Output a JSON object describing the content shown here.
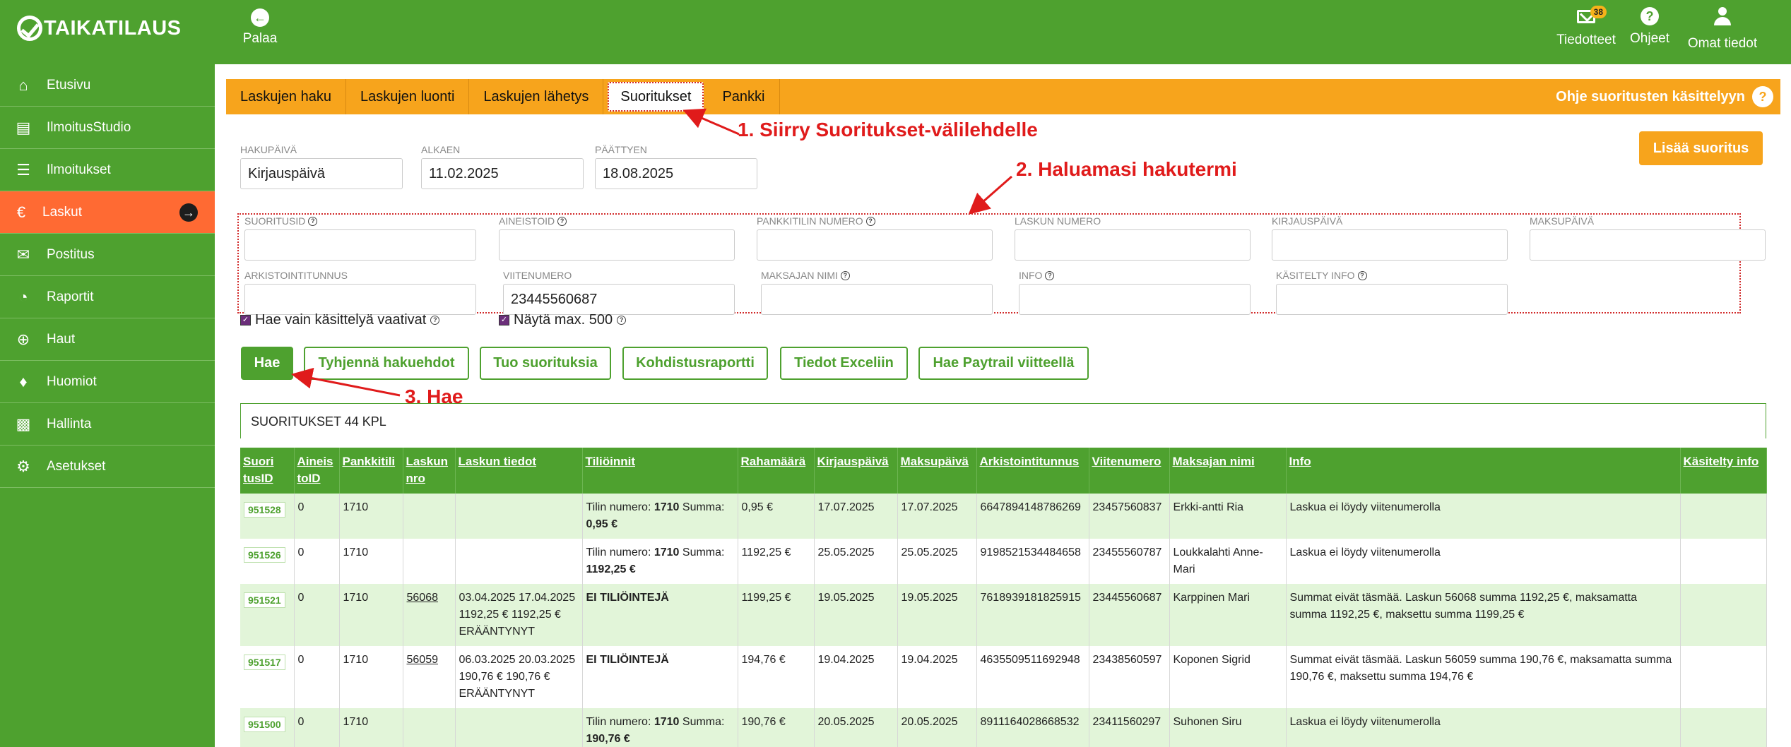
{
  "topbar": {
    "logo_text": "TAIKATILAUS",
    "back_label": "Palaa",
    "notifications_label": "Tiedotteet",
    "notifications_count": "38",
    "help_label": "Ohjeet",
    "profile_label": "Omat tiedot"
  },
  "sidebar": {
    "items": [
      {
        "label": "Etusivu",
        "icon": "home-icon"
      },
      {
        "label": "IlmoitusStudio",
        "icon": "newspaper-icon"
      },
      {
        "label": "Ilmoitukset",
        "icon": "list-icon"
      },
      {
        "label": "Laskut",
        "icon": "euro-icon",
        "active": true
      },
      {
        "label": "Postitus",
        "icon": "envelope-icon"
      },
      {
        "label": "Raportit",
        "icon": "pie-chart-icon"
      },
      {
        "label": "Haut",
        "icon": "search-plus-icon"
      },
      {
        "label": "Huomiot",
        "icon": "bell-icon"
      },
      {
        "label": "Hallinta",
        "icon": "cubes-icon"
      },
      {
        "label": "Asetukset",
        "icon": "gear-icon"
      }
    ]
  },
  "tabs": {
    "items": [
      "Laskujen haku",
      "Laskujen luonti",
      "Laskujen lähetys",
      "Suoritukset",
      "Pankki"
    ],
    "help_text": "Ohje suoritusten käsittelyyn"
  },
  "annotations": {
    "step1": "1. Siirry Suoritukset-välilehdelle",
    "step2": "2. Haluamasi hakutermi",
    "step3": "3. Hae"
  },
  "search": {
    "hakupaiva_label": "HAKUPÄIVÄ",
    "hakupaiva_value": "Kirjauspäivä",
    "alkaen_label": "ALKAEN",
    "alkaen_value": "11.02.2025",
    "paattyen_label": "PÄÄTTYEN",
    "paattyen_value": "18.08.2025",
    "add_button": "Lisää suoritus"
  },
  "filters": {
    "suoritusid": "SUORITUSID",
    "aineistoid": "AINEISTOID",
    "pankkitili": "PANKKITILIN NUMERO",
    "laskun_numero": "LASKUN NUMERO",
    "kirjauspaiva": "KIRJAUSPÄIVÄ",
    "maksupaiva": "MAKSUPÄIVÄ",
    "arkistointitunnus": "ARKISTOINTITUNNUS",
    "viitenumero": "VIITENUMERO",
    "viitenumero_value": "23445560687",
    "maksajan_nimi": "MAKSAJAN NIMI",
    "info": "INFO",
    "kasitelty_info": "KÄSITELTY INFO",
    "chk_only_required": "Hae vain käsittelyä vaativat",
    "chk_max500": "Näytä max. 500"
  },
  "buttons": {
    "hae": "Hae",
    "tyhjenna": "Tyhjennä hakuehdot",
    "tuo": "Tuo suorituksia",
    "kohdistus": "Kohdistusraportti",
    "excel": "Tiedot Exceliin",
    "paytrail": "Hae Paytrail viitteellä"
  },
  "results": {
    "count_text": "SUORITUKSET 44 KPL",
    "headers": [
      "Suori tusID",
      "Aineis toID",
      "Pankkitili",
      "Laskun nro",
      "Laskun tiedot",
      "Tiliöinnit",
      "Rahamäärä",
      "Kirjauspäivä",
      "Maksupäivä",
      "Arkistointitunnus",
      "Viitenumero",
      "Maksajan nimi",
      "Info",
      "Käsitelty info"
    ],
    "rows": [
      {
        "id": "951528",
        "aineisto": "0",
        "tili": "1710",
        "laskunro": "",
        "tiedot": "",
        "tilioinnit_prefix": "Tilin numero:",
        "tilioinnit_tili": "1710",
        "tilioinnit_summa_label": "Summa:",
        "tilioinnit_summa": "0,95 €",
        "summa": "0,95 €",
        "kirjaus": "17.07.2025",
        "maksu": "17.07.2025",
        "arkisto": "6647894148786269",
        "viite": "23457560837",
        "maksaja": "Erkki-antti Ria",
        "info": "Laskua ei löydy viitenumerolla",
        "kasitelty": ""
      },
      {
        "id": "951526",
        "aineisto": "0",
        "tili": "1710",
        "laskunro": "",
        "tiedot": "",
        "tilioinnit_prefix": "Tilin numero:",
        "tilioinnit_tili": "1710",
        "tilioinnit_summa_label": "Summa:",
        "tilioinnit_summa": "1192,25 €",
        "summa": "1192,25 €",
        "kirjaus": "25.05.2025",
        "maksu": "25.05.2025",
        "arkisto": "9198521534484658",
        "viite": "23455560787",
        "maksaja": "Loukkalahti Anne-Mari",
        "info": "Laskua ei löydy viitenumerolla",
        "kasitelty": ""
      },
      {
        "id": "951521",
        "aineisto": "0",
        "tili": "1710",
        "laskunro": "56068",
        "tiedot": "03.04.2025 17.04.2025 1192,25 € 1192,25 € ERÄÄNTYNYT",
        "tilioinnit_plain": "EI TILIÖINTEJÄ",
        "summa": "1199,25 €",
        "kirjaus": "19.05.2025",
        "maksu": "19.05.2025",
        "arkisto": "7618939181825915",
        "viite": "23445560687",
        "maksaja": "Karppinen Mari",
        "info": "Summat eivät täsmää. Laskun 56068 summa 1192,25 €, maksamatta summa 1192,25 €, maksettu summa 1199,25 €",
        "kasitelty": ""
      },
      {
        "id": "951517",
        "aineisto": "0",
        "tili": "1710",
        "laskunro": "56059",
        "tiedot": "06.03.2025 20.03.2025 190,76 € 190,76 € ERÄÄNTYNYT",
        "tilioinnit_plain": "EI TILIÖINTEJÄ",
        "summa": "194,76 €",
        "kirjaus": "19.04.2025",
        "maksu": "19.04.2025",
        "arkisto": "4635509511692948",
        "viite": "23438560597",
        "maksaja": "Koponen Sigrid",
        "info": "Summat eivät täsmää. Laskun 56059 summa 190,76 €, maksamatta summa 190,76 €, maksettu summa 194,76 €",
        "kasitelty": ""
      },
      {
        "id": "951500",
        "aineisto": "0",
        "tili": "1710",
        "laskunro": "",
        "tiedot": "",
        "tilioinnit_prefix": "Tilin numero:",
        "tilioinnit_tili": "1710",
        "tilioinnit_summa_label": "Summa:",
        "tilioinnit_summa": "190,76 €",
        "summa": "190,76 €",
        "kirjaus": "20.05.2025",
        "maksu": "20.05.2025",
        "arkisto": "8911164028668532",
        "viite": "23411560297",
        "maksaja": "Suhonen Siru",
        "info": "Laskua ei löydy viitenumerolla",
        "kasitelty": ""
      }
    ]
  },
  "colors": {
    "brand_green": "#4ea12f",
    "tab_orange": "#f7a41c",
    "active_sidebar": "#ff6a33",
    "annotation_red": "#e01b1b"
  }
}
